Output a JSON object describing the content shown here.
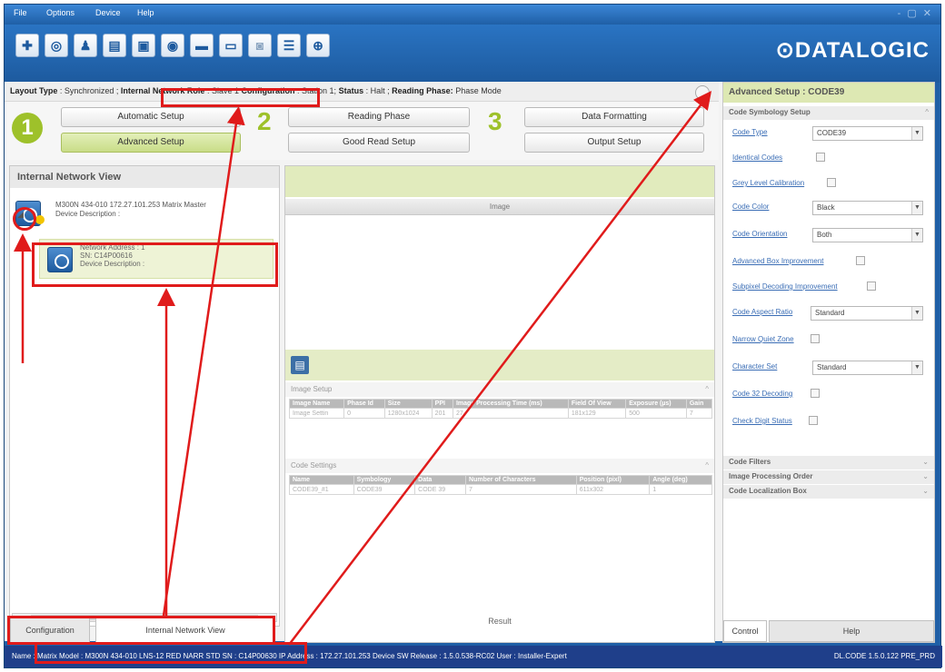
{
  "menu": {
    "file": "File",
    "options": "Options",
    "device": "Device",
    "help": "Help"
  },
  "window_controls": "- ▢ ✕",
  "logo": "DATALOGIC",
  "toolbar_icons": [
    "add-icon",
    "camera-icon",
    "user-icon",
    "grid-icon",
    "monitor-icon",
    "capture-icon",
    "image-icon",
    "window-icon",
    "gray-image-icon",
    "settings-icon",
    "target-icon"
  ],
  "status_line": {
    "layout_type_label": "Layout Type",
    "layout_type_value": ": Synchronized ;",
    "network_role_label": "Internal Network Role",
    "network_role_value": ": Slave 1",
    "configuration_label": "Configuration",
    "configuration_value": ": Station 1;",
    "status_label": "Status",
    "status_value": ": Halt ;",
    "reading_phase_label": "Reading Phase:",
    "reading_phase_value": "Phase Mode"
  },
  "steps": {
    "step1": "1",
    "step2": "2",
    "step3": "3",
    "automatic_setup": "Automatic Setup",
    "advanced_setup": "Advanced Setup",
    "reading_phase": "Reading Phase",
    "good_read_setup": "Good Read Setup",
    "data_formatting": "Data Formatting",
    "output_setup": "Output Setup"
  },
  "left_panel": {
    "title": "Internal Network View",
    "master_line1": "M300N 434-010 172.27.101.253 Matrix Master",
    "master_line2": "Device Description :",
    "slave_line1": "Network Address :  1",
    "slave_line2": "SN:  C14P00616",
    "slave_line3": "Device Description :",
    "slave_badge": "1",
    "scroll_label": "III"
  },
  "bottom_tabs": {
    "configuration": "Configuration",
    "internal_network_view": "Internal Network View"
  },
  "center": {
    "image_header": "Image",
    "image_setup": "Image Setup",
    "image_table_headers": [
      "Image Name",
      "Phase Id",
      "Size",
      "PPI",
      "Image Processing Time (ms)",
      "Field Of View",
      "Exposure (µs)",
      "Gain"
    ],
    "image_table_row": [
      "Image Settin",
      "0",
      "1280x1024",
      "201",
      "27",
      "181x129",
      "500",
      "7"
    ],
    "code_settings": "Code Settings",
    "code_table_headers": [
      "Name",
      "Symbology",
      "Data",
      "Number of Characters",
      "Position (pixl)",
      "Angle (deg)"
    ],
    "code_table_row": [
      "CODE39_#1",
      "CODE39",
      "CODE 39",
      "7",
      "611x302",
      "1"
    ],
    "result": "Result"
  },
  "right_panel": {
    "title": "Advanced Setup :  CODE39",
    "code_symbology_setup": "Code Symbology Setup",
    "code_type_label": "Code Type",
    "code_type_value": "CODE39",
    "identical_codes": "Identical Codes",
    "grey_level": "Grey Level Calibration",
    "code_color_label": "Code Color",
    "code_color_value": "Black",
    "code_orientation_label": "Code Orientation",
    "code_orientation_value": "Both",
    "advanced_box": "Advanced Box Improvement",
    "subpixel": "Subpixel Decoding Improvement",
    "aspect_label": "Code Aspect Ratio",
    "aspect_value": "Standard",
    "narrow_quiet": "Narrow Quiet Zone",
    "char_set_label": "Character Set",
    "char_set_value": "Standard",
    "code32": "Code 32 Decoding",
    "check_digit": "Check Digit Status",
    "code_filters": "Code Filters",
    "image_processing_order": "Image Processing Order",
    "code_localization_box": "Code Localization Box",
    "control_tab": "Control",
    "help_tab": "Help"
  },
  "statusbar": {
    "left": "Name : Matrix   Model : M300N 434-010 LNS-12 RED NARR STD   SN : C14P00630   IP Address : 172.27.101.253   Device SW Release : 1.5.0.538-RC02   User : Installer-Expert",
    "right": "DL.CODE 1.5.0.122 PRE_PRD"
  },
  "colors": {
    "accent_green": "#9ec12a",
    "title_blue": "#1f5fa6",
    "annotation_red": "#e01b1b"
  }
}
